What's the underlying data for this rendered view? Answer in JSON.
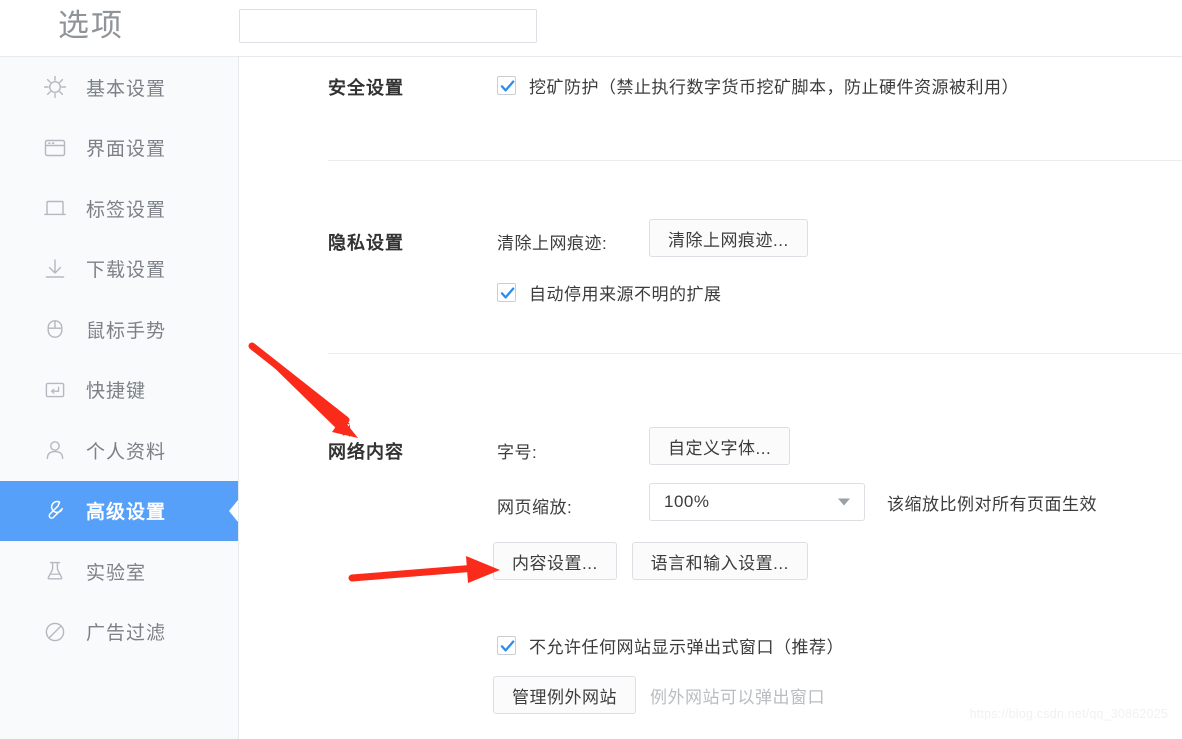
{
  "header": {
    "title": "选项",
    "search_value": "",
    "search_placeholder": ""
  },
  "sidebar": {
    "items": [
      {
        "label": "基本设置",
        "icon": "gear-icon",
        "active": false
      },
      {
        "label": "界面设置",
        "icon": "window-icon",
        "active": false
      },
      {
        "label": "标签设置",
        "icon": "tab-icon",
        "active": false
      },
      {
        "label": "下载设置",
        "icon": "download-icon",
        "active": false
      },
      {
        "label": "鼠标手势",
        "icon": "mouse-icon",
        "active": false
      },
      {
        "label": "快捷键",
        "icon": "enter-key-icon",
        "active": false
      },
      {
        "label": "个人资料",
        "icon": "person-icon",
        "active": false
      },
      {
        "label": "高级设置",
        "icon": "wrench-icon",
        "active": true
      },
      {
        "label": "实验室",
        "icon": "flask-icon",
        "active": false
      },
      {
        "label": "广告过滤",
        "icon": "block-icon",
        "active": false
      }
    ],
    "active_color": "#56a0fa",
    "background": "#f8fafc"
  },
  "sections": {
    "security": {
      "title": "安全设置",
      "mining_protection": {
        "label": "挖矿防护（禁止执行数字货币挖矿脚本，防止硬件资源被利用）",
        "checked": true
      }
    },
    "privacy": {
      "title": "隐私设置",
      "clear_traces_label": "清除上网痕迹:",
      "clear_traces_button": "清除上网痕迹...",
      "auto_disable_ext": {
        "label": "自动停用来源不明的扩展",
        "checked": true
      }
    },
    "network": {
      "title": "网络内容",
      "font_size_label": "字号:",
      "custom_font_button": "自定义字体...",
      "page_zoom_label": "网页缩放:",
      "page_zoom_value": "100%",
      "page_zoom_hint": "该缩放比例对所有页面生效",
      "content_settings_button": "内容设置...",
      "language_input_button": "语言和输入设置...",
      "block_popups": {
        "label": "不允许任何网站显示弹出式窗口（推荐）",
        "checked": true
      },
      "manage_exceptions_button": "管理例外网站",
      "manage_exceptions_hint": "例外网站可以弹出窗口"
    }
  },
  "annotations": {
    "arrow_color": "#fb2b1b",
    "arrow_1_target": "网络内容",
    "arrow_2_target": "内容设置..."
  },
  "watermark": {
    "text": "https://blog.csdn.net/qq_30862025"
  }
}
